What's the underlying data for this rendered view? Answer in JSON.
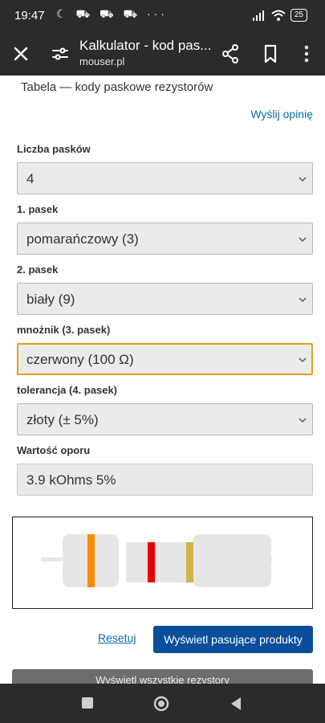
{
  "status_bar": {
    "time": "19:47",
    "left_icons": "☾ ⛟ ⛟ ⛟ ···",
    "battery": "25"
  },
  "tab_header": {
    "title": "Kalkulator - kod pas...",
    "url": "mouser.pl"
  },
  "page": {
    "breadcrumb": "Tabela — kody paskowe rezystorów",
    "feedback_link": "Wyślij opinię"
  },
  "form": {
    "band_count": {
      "label": "Liczba pasków",
      "value": "4"
    },
    "band1": {
      "label": "1. pasek",
      "value": "pomarańczowy (3)"
    },
    "band2": {
      "label": "2. pasek",
      "value": "biały (9)"
    },
    "multiplier": {
      "label": "mnożnik (3. pasek)",
      "value": "czerwony (100 Ω)"
    },
    "tolerance": {
      "label": "tolerancja (4. pasek)",
      "value": "złoty (± 5%)"
    },
    "result": {
      "label": "Wartość oporu",
      "value": "3.9 kOhms 5%"
    }
  },
  "resistor": {
    "band_colors": [
      "#ff8a00",
      "#e60000",
      "#d4b24a"
    ],
    "body_color": "#e6e6e6"
  },
  "actions": {
    "reset": "Resetuj",
    "show_products": "Wyświetl pasujące produkty",
    "show_all": "Wyświetl wszystkie rezystory"
  },
  "colors": {
    "primary": "#0b4f9c",
    "link": "#0b6aa3",
    "focus": "#e5a11d"
  }
}
